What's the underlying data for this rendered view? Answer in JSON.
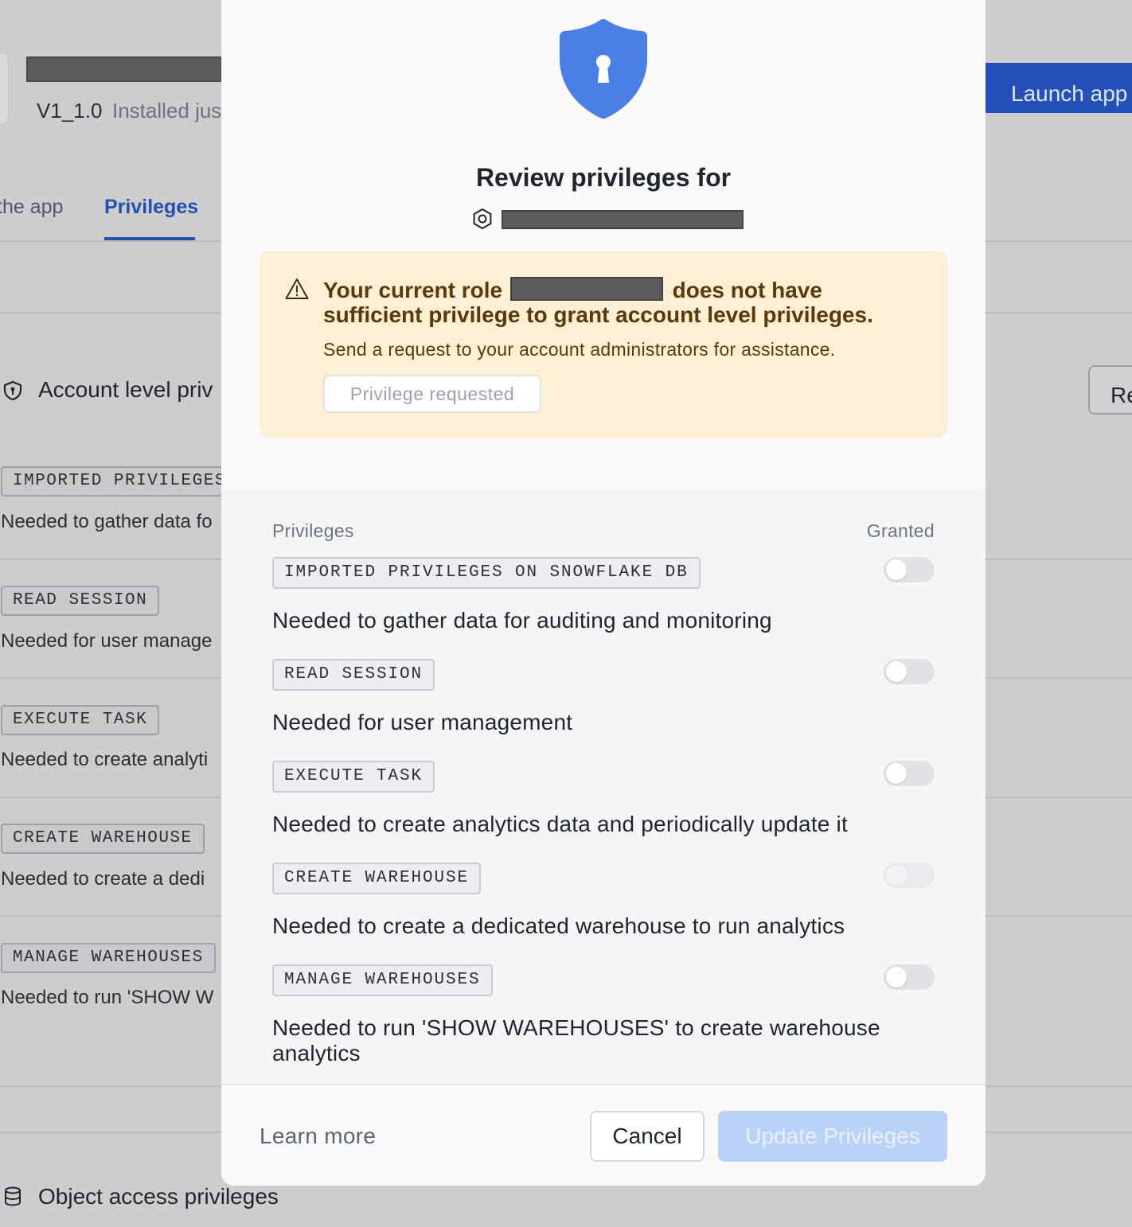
{
  "background": {
    "version": "V1_1.0",
    "installed": "Installed jus",
    "launch_button": "Launch app",
    "tabs": [
      {
        "label": "the app",
        "active": false
      },
      {
        "label": "Privileges",
        "active": true
      }
    ],
    "account_section_title": "Account level priv",
    "right_button": "Re",
    "privileges": [
      {
        "name": "IMPORTED PRIVILEGES",
        "description": "Needed to gather data fo"
      },
      {
        "name": "READ SESSION",
        "description": "Needed for user manage"
      },
      {
        "name": "EXECUTE TASK",
        "description": "Needed to create analyti"
      },
      {
        "name": "CREATE WAREHOUSE",
        "description": "Needed to create a dedi"
      },
      {
        "name": "MANAGE WAREHOUSES",
        "description": "Needed to run 'SHOW W"
      }
    ],
    "object_section_title": "Object access privileges"
  },
  "modal": {
    "title": "Review privileges for",
    "alert": {
      "line1_before": "Your current role",
      "line1_after": "does not have",
      "line2": "sufficient privilege to grant account level privileges.",
      "subtext": "Send a request to your account administrators for assistance.",
      "button": "Privilege requested"
    },
    "columns": {
      "left": "Privileges",
      "right": "Granted"
    },
    "privileges": [
      {
        "name": "IMPORTED PRIVILEGES ON SNOWFLAKE DB",
        "description": "Needed to gather data for auditing and monitoring",
        "granted": false
      },
      {
        "name": "READ SESSION",
        "description": "Needed for user management",
        "granted": false
      },
      {
        "name": "EXECUTE TASK",
        "description": "Needed to create analytics data and periodically update it",
        "granted": false
      },
      {
        "name": "CREATE WAREHOUSE",
        "description": "Needed to create a dedicated warehouse to run analytics",
        "granted": false
      },
      {
        "name": "MANAGE WAREHOUSES",
        "description": "Needed to run 'SHOW WAREHOUSES' to create warehouse analytics",
        "granted": false
      }
    ],
    "footer": {
      "learn_more": "Learn more",
      "cancel": "Cancel",
      "update": "Update Privileges"
    }
  },
  "colors": {
    "accent": "#2351b8",
    "shield": "#4a80e6",
    "alert_bg": "#fcefd3",
    "alert_text": "#5a3a08",
    "update_disabled": "#b9d3f8"
  },
  "icons": [
    "shield-lock-icon",
    "app-hexagon-icon",
    "warning-triangle-icon",
    "shield-icon",
    "database-icon"
  ]
}
